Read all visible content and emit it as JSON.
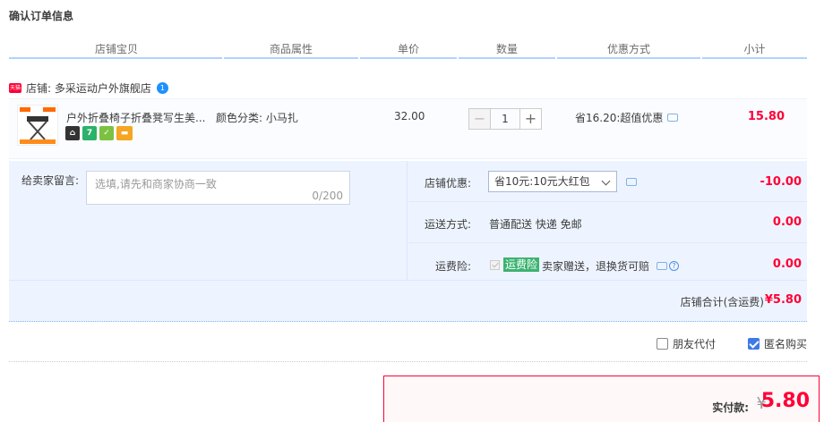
{
  "page": {
    "title": "确认订单信息"
  },
  "columns": [
    "店铺宝贝",
    "商品属性",
    "单价",
    "数量",
    "优惠方式",
    "小计"
  ],
  "store": {
    "badge": "天猫",
    "label": "店铺: 多采运动户外旗舰店",
    "chat_badge": "1"
  },
  "item": {
    "title": "户外折叠椅子折叠凳写生美...",
    "attribute": "颜色分类: 小马扎",
    "service_icons": [
      {
        "name": "service-7day-icon",
        "text": "7",
        "color": "#2ab26a"
      },
      {
        "name": "service-android-icon",
        "text": "✓",
        "color": "#7cc242"
      },
      {
        "name": "service-card-icon",
        "text": "▬",
        "color": "#f5a623"
      }
    ],
    "price": "32.00",
    "quantity": "1",
    "qty_minus": "−",
    "qty_plus": "+",
    "promotion": "省16.20:超值优惠",
    "subtotal": "15.80"
  },
  "message": {
    "label": "给卖家留言:",
    "placeholder": "选填,请先和商家协商一致",
    "count": "0/200"
  },
  "discount": {
    "label": "店铺优惠:",
    "selected": "省10元:10元大红包",
    "amount": "-10.00"
  },
  "shipping": {
    "label": "运送方式:",
    "value": "普通配送 快递 免邮",
    "amount": "0.00"
  },
  "insurance": {
    "label": "运费险:",
    "tag": "运费险",
    "text": "卖家赠送，退换货可赔",
    "help": "?",
    "amount": "0.00"
  },
  "store_total": {
    "label": "店铺合计(含运费)",
    "amount": "¥5.80"
  },
  "options": {
    "friend_pay": "朋友代付",
    "anonymous": "匿名购买"
  },
  "payment": {
    "label": "实付款:",
    "currency": "¥",
    "amount": "5.80"
  },
  "colors": {
    "accent": "#ff0036",
    "header_bar": "#b2d1ff",
    "panel_bg": "#eef4ff"
  }
}
